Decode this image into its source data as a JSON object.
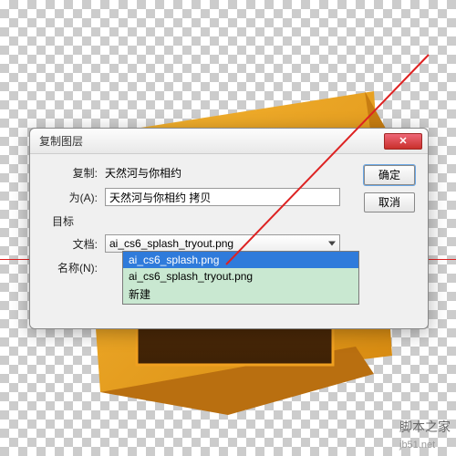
{
  "dialog": {
    "title": "复制图层",
    "copy_label": "复制:",
    "copy_value": "天然河与你相约",
    "as_label": "为(A):",
    "as_value": "天然河与你相约 拷贝",
    "target_label": "目标",
    "doc_label": "文档:",
    "doc_value": "ai_cs6_splash_tryout.png",
    "name_label": "名称(N):",
    "ok_label": "确定",
    "cancel_label": "取消"
  },
  "dropdown": {
    "options": [
      "ai_cs6_splash.png",
      "ai_cs6_splash_tryout.png",
      "新建"
    ],
    "selected_index": 0
  },
  "watermark": {
    "text": "脚本之家",
    "url": "jb51.net"
  }
}
